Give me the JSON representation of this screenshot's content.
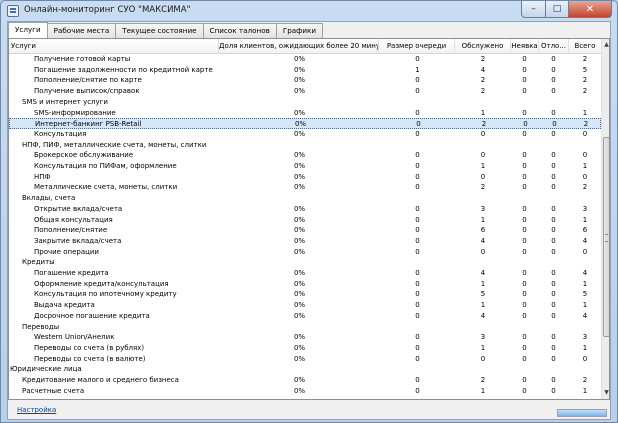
{
  "window": {
    "title": "Онлайн-мониторинг СУО \"МАКСИМА\"",
    "controls": {
      "minimize": "–",
      "maximize": "□",
      "close": "✕"
    }
  },
  "tabs": [
    "Услуги",
    "Рабочие места",
    "Текущее состояние",
    "Список талонов",
    "Графики"
  ],
  "active_tab": 0,
  "columns": [
    "Услуги",
    "Доля клиентов, ожидающих более 20 минут",
    "Размер очереди",
    "Обслужено",
    "Неявка",
    "Отло...",
    "Всего"
  ],
  "rows": [
    {
      "name": "Получение готовой карты",
      "level": 2,
      "v": [
        "0%",
        "0",
        "2",
        "0",
        "0",
        "2"
      ]
    },
    {
      "name": "Погашение задолженности по кредитной карте",
      "level": 2,
      "v": [
        "0%",
        "1",
        "4",
        "0",
        "0",
        "5"
      ]
    },
    {
      "name": "Пополнение/снятие по карте",
      "level": 2,
      "v": [
        "0%",
        "0",
        "2",
        "0",
        "0",
        "2"
      ]
    },
    {
      "name": "Получение выписок/справок",
      "level": 2,
      "v": [
        "0%",
        "0",
        "2",
        "0",
        "0",
        "2"
      ]
    },
    {
      "name": "SMS и интернет услуги",
      "level": 1,
      "v": []
    },
    {
      "name": "SMS-информирование",
      "level": 2,
      "v": [
        "0%",
        "0",
        "1",
        "0",
        "0",
        "1"
      ]
    },
    {
      "name": "Интернет-банкинг PSB-Retail",
      "level": 2,
      "v": [
        "0%",
        "0",
        "2",
        "0",
        "0",
        "2"
      ],
      "selected": true
    },
    {
      "name": "Консультация",
      "level": 2,
      "v": [
        "0%",
        "0",
        "0",
        "0",
        "0",
        "0"
      ]
    },
    {
      "name": "НПФ, ПИФ, металлические счета, монеты, слитки",
      "level": 1,
      "v": []
    },
    {
      "name": "Брокерское обслуживание",
      "level": 2,
      "v": [
        "0%",
        "0",
        "0",
        "0",
        "0",
        "0"
      ]
    },
    {
      "name": "Консультация по ПИФам, оформление",
      "level": 2,
      "v": [
        "0%",
        "0",
        "1",
        "0",
        "0",
        "1"
      ]
    },
    {
      "name": "НПФ",
      "level": 2,
      "v": [
        "0%",
        "0",
        "0",
        "0",
        "0",
        "0"
      ]
    },
    {
      "name": "Металлические счета, монеты, слитки",
      "level": 2,
      "v": [
        "0%",
        "0",
        "2",
        "0",
        "0",
        "2"
      ]
    },
    {
      "name": "Вклады, счета",
      "level": 1,
      "v": []
    },
    {
      "name": "Открытие вклада/счета",
      "level": 2,
      "v": [
        "0%",
        "0",
        "3",
        "0",
        "0",
        "3"
      ]
    },
    {
      "name": "Общая консультация",
      "level": 2,
      "v": [
        "0%",
        "0",
        "1",
        "0",
        "0",
        "1"
      ]
    },
    {
      "name": "Пополнение/снятие",
      "level": 2,
      "v": [
        "0%",
        "0",
        "6",
        "0",
        "0",
        "6"
      ]
    },
    {
      "name": "Закрытие вклада/счета",
      "level": 2,
      "v": [
        "0%",
        "0",
        "4",
        "0",
        "0",
        "4"
      ]
    },
    {
      "name": "Прочие операции",
      "level": 2,
      "v": [
        "0%",
        "0",
        "0",
        "0",
        "0",
        "0"
      ]
    },
    {
      "name": "Кредиты",
      "level": 1,
      "v": []
    },
    {
      "name": "Погашение кредита",
      "level": 2,
      "v": [
        "0%",
        "0",
        "4",
        "0",
        "0",
        "4"
      ]
    },
    {
      "name": "Оформление кредита/консультация",
      "level": 2,
      "v": [
        "0%",
        "0",
        "1",
        "0",
        "0",
        "1"
      ]
    },
    {
      "name": "Консультация по ипотечному кредиту",
      "level": 2,
      "v": [
        "0%",
        "0",
        "5",
        "0",
        "0",
        "5"
      ]
    },
    {
      "name": "Выдача кредита",
      "level": 2,
      "v": [
        "0%",
        "0",
        "1",
        "0",
        "0",
        "1"
      ]
    },
    {
      "name": "Досрочное погашение кредита",
      "level": 2,
      "v": [
        "0%",
        "0",
        "4",
        "0",
        "0",
        "4"
      ]
    },
    {
      "name": "Переводы",
      "level": 1,
      "v": []
    },
    {
      "name": "Western Union/Анелик",
      "level": 2,
      "v": [
        "0%",
        "0",
        "3",
        "0",
        "0",
        "3"
      ]
    },
    {
      "name": "Переводы со счета (в рублях)",
      "level": 2,
      "v": [
        "0%",
        "0",
        "1",
        "0",
        "0",
        "1"
      ]
    },
    {
      "name": "Переводы со счета (в валюте)",
      "level": 2,
      "v": [
        "0%",
        "0",
        "0",
        "0",
        "0",
        "0"
      ]
    },
    {
      "name": "Юридические лица",
      "level": 0,
      "v": []
    },
    {
      "name": "Кредитование малого и среднего бизнеса",
      "level": 1,
      "v": [
        "0%",
        "0",
        "2",
        "0",
        "0",
        "2"
      ]
    },
    {
      "name": "Расчетные счета",
      "level": 1,
      "v": [
        "0%",
        "0",
        "1",
        "0",
        "0",
        "1"
      ]
    }
  ],
  "footer": {
    "settings_link": "Настройка",
    "progress": 1.0
  }
}
